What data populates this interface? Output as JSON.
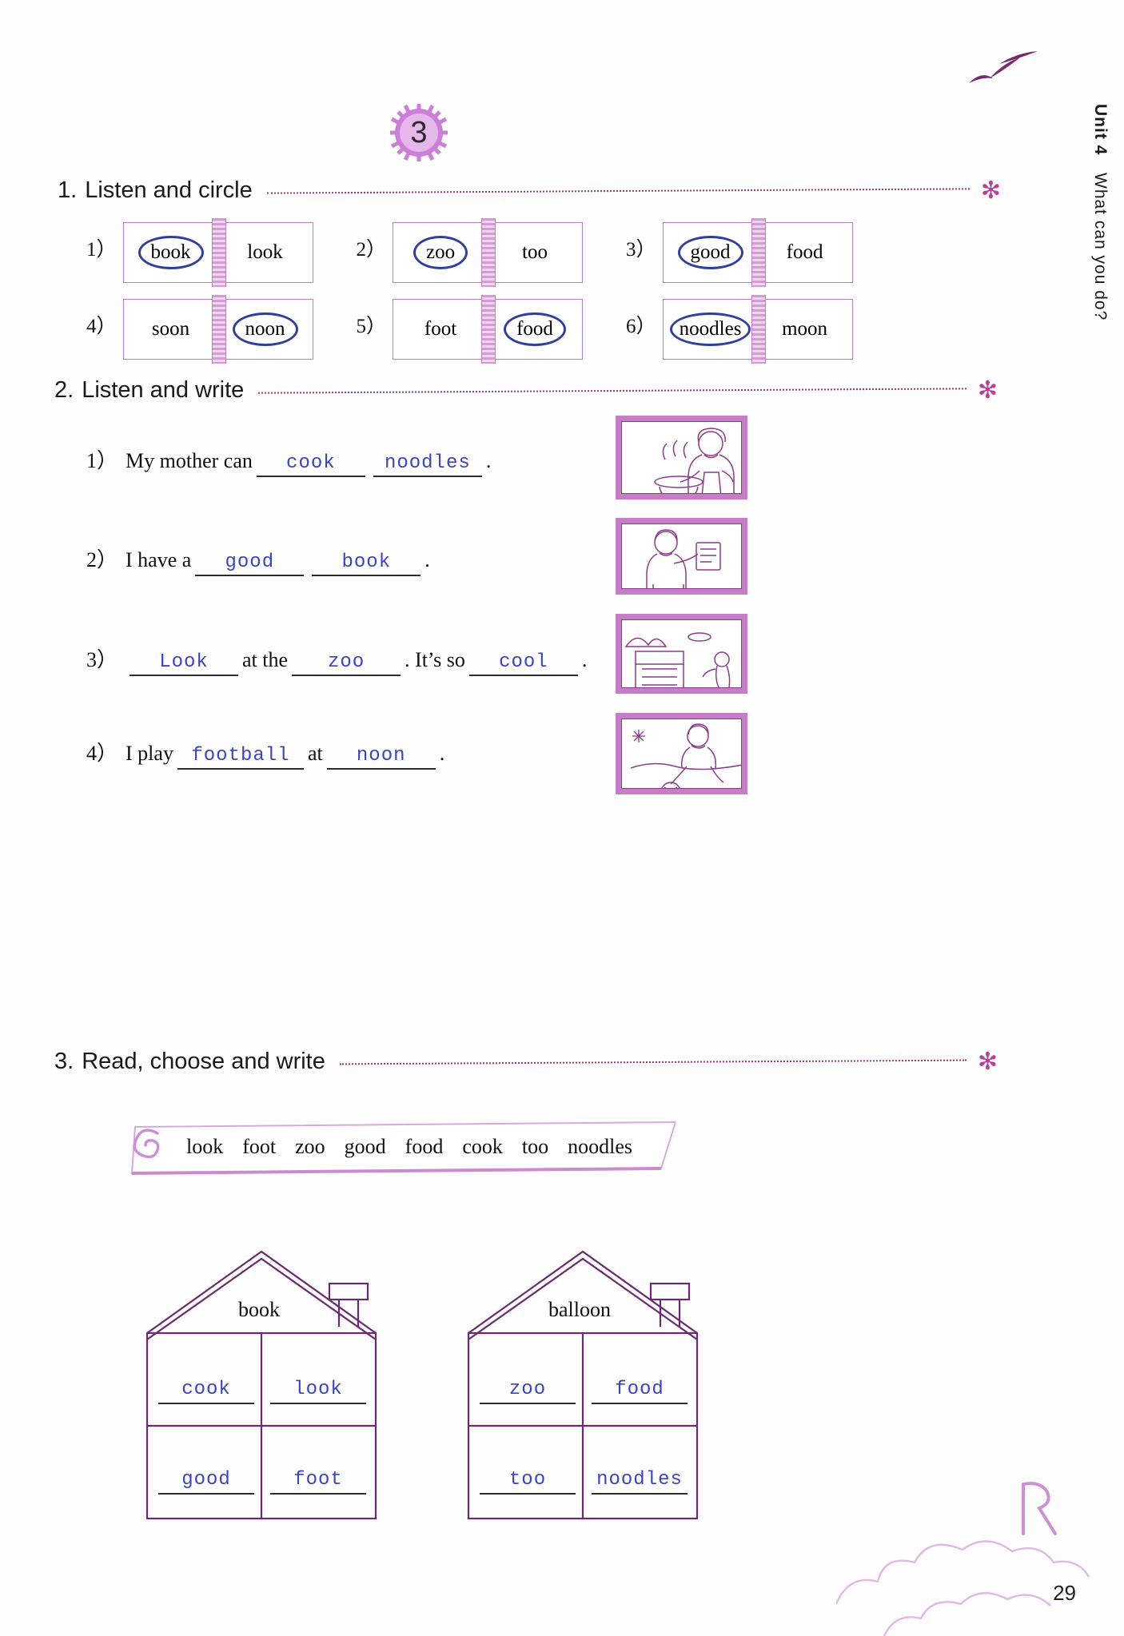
{
  "page": {
    "lesson_number": "3",
    "page_number": "29",
    "side_tab_unit": "Unit 4",
    "side_tab_title": "What can you do?",
    "accent_purple": "#a0366f",
    "ink_blue": "#3a44c4",
    "line_purple": "#8c3a8c",
    "notebook_purple": "#c07dc0"
  },
  "exercise1": {
    "number": "1.",
    "title": "Listen and circle",
    "star": "✻",
    "items": [
      {
        "index": "1）",
        "left": "book",
        "right": "look",
        "circled": "left"
      },
      {
        "index": "2）",
        "left": "zoo",
        "right": "too",
        "circled": "left"
      },
      {
        "index": "3）",
        "left": "good",
        "right": "food",
        "circled": "left"
      },
      {
        "index": "4）",
        "left": "soon",
        "right": "noon",
        "circled": "right"
      },
      {
        "index": "5）",
        "left": "foot",
        "right": "food",
        "circled": "right"
      },
      {
        "index": "6）",
        "left": "noodles",
        "right": "moon",
        "circled": "left"
      }
    ]
  },
  "exercise2": {
    "number": "2.",
    "title": "Listen and write",
    "star": "✻",
    "items": [
      {
        "index": "1）",
        "parts": [
          {
            "type": "text",
            "value": "My mother can"
          },
          {
            "type": "blank",
            "value": "cook",
            "size": "b-md"
          },
          {
            "type": "blank",
            "value": "noodles",
            "size": "b-md"
          },
          {
            "type": "text",
            "value": "."
          }
        ],
        "picture": "mother-cooking-noodles"
      },
      {
        "index": "2）",
        "parts": [
          {
            "type": "text",
            "value": "I have a"
          },
          {
            "type": "blank",
            "value": "good",
            "size": "b-md"
          },
          {
            "type": "blank",
            "value": "book",
            "size": "b-md"
          },
          {
            "type": "text",
            "value": "."
          }
        ],
        "picture": "boy-holding-book"
      },
      {
        "index": "3）",
        "parts": [
          {
            "type": "blank",
            "value": "Look",
            "size": "b-md"
          },
          {
            "type": "text",
            "value": "at the"
          },
          {
            "type": "blank",
            "value": "zoo",
            "size": "b-md"
          },
          {
            "type": "text",
            "value": ". It’s so"
          },
          {
            "type": "blank",
            "value": "cool",
            "size": "b-md"
          },
          {
            "type": "text",
            "value": "."
          }
        ],
        "picture": "zoo-entrance"
      },
      {
        "index": "4）",
        "parts": [
          {
            "type": "text",
            "value": "I play"
          },
          {
            "type": "blank",
            "value": "football",
            "size": "b-lg"
          },
          {
            "type": "text",
            "value": "at"
          },
          {
            "type": "blank",
            "value": "noon",
            "size": "b-md"
          },
          {
            "type": "text",
            "value": "."
          }
        ],
        "picture": "boy-playing-football"
      }
    ]
  },
  "exercise3": {
    "number": "3.",
    "title": "Read, choose and write",
    "star": "✻",
    "word_bank": [
      "look",
      "foot",
      "zoo",
      "good",
      "food",
      "cook",
      "too",
      "noodles"
    ],
    "houses": [
      {
        "name": "house-book",
        "roof_label": "book",
        "cells": [
          "cook",
          "look",
          "good",
          "foot"
        ]
      },
      {
        "name": "house-balloon",
        "roof_label": "balloon",
        "cells": [
          "zoo",
          "food",
          "too",
          "noodles"
        ]
      }
    ]
  }
}
